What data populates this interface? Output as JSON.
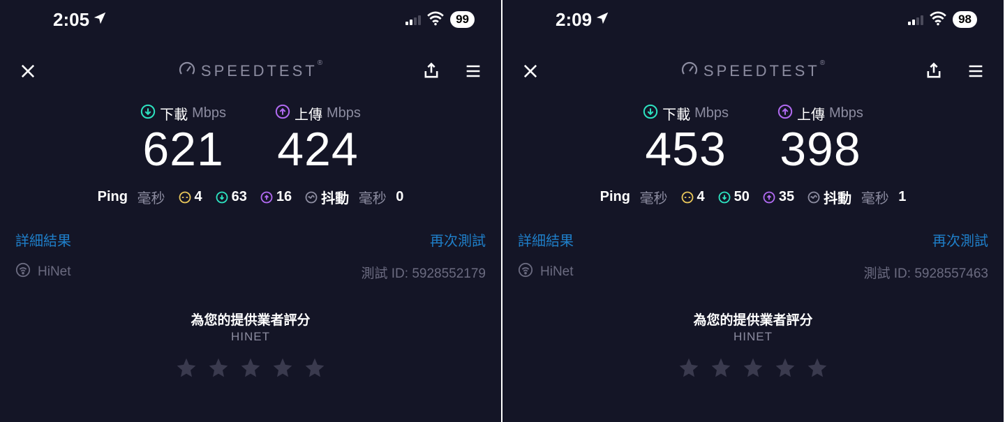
{
  "panels": [
    {
      "status": {
        "time": "2:05",
        "battery": "99"
      },
      "app_title": "SPEEDTEST",
      "download": {
        "label": "下載",
        "unit": "Mbps",
        "value": "621"
      },
      "upload": {
        "label": "上傳",
        "unit": "Mbps",
        "value": "424"
      },
      "ping": {
        "label": "Ping",
        "unit": "毫秒",
        "idle": "4",
        "down": "63",
        "up": "16",
        "jitter_label": "抖動",
        "jitter_unit": "毫秒",
        "jitter": "0"
      },
      "links": {
        "details": "詳細結果",
        "retest": "再次測試"
      },
      "provider": {
        "name": "HiNet",
        "test_id_label": "測試 ID:",
        "test_id": "5928552179"
      },
      "rating": {
        "title": "為您的提供業者評分",
        "sub": "HINET"
      }
    },
    {
      "status": {
        "time": "2:09",
        "battery": "98"
      },
      "app_title": "SPEEDTEST",
      "download": {
        "label": "下載",
        "unit": "Mbps",
        "value": "453"
      },
      "upload": {
        "label": "上傳",
        "unit": "Mbps",
        "value": "398"
      },
      "ping": {
        "label": "Ping",
        "unit": "毫秒",
        "idle": "4",
        "down": "50",
        "up": "35",
        "jitter_label": "抖動",
        "jitter_unit": "毫秒",
        "jitter": "1"
      },
      "links": {
        "details": "詳細結果",
        "retest": "再次測試"
      },
      "provider": {
        "name": "HiNet",
        "test_id_label": "測試 ID:",
        "test_id": "5928557463"
      },
      "rating": {
        "title": "為您的提供業者評分",
        "sub": "HINET"
      }
    }
  ]
}
